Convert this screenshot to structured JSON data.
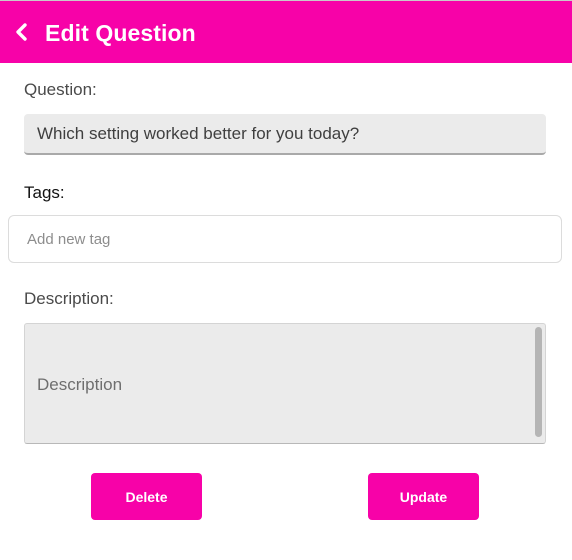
{
  "header": {
    "title": "Edit Question",
    "back_icon": "chevron-left-icon",
    "background_color": "#f702a8"
  },
  "question": {
    "label": "Question:",
    "value": "Which setting worked better for you today?"
  },
  "tags": {
    "label": "Tags:",
    "placeholder": "Add new tag",
    "value": ""
  },
  "description": {
    "label": "Description:",
    "placeholder": "Description",
    "value": ""
  },
  "actions": {
    "delete_label": "Delete",
    "update_label": "Update",
    "button_color": "#f702a8"
  }
}
